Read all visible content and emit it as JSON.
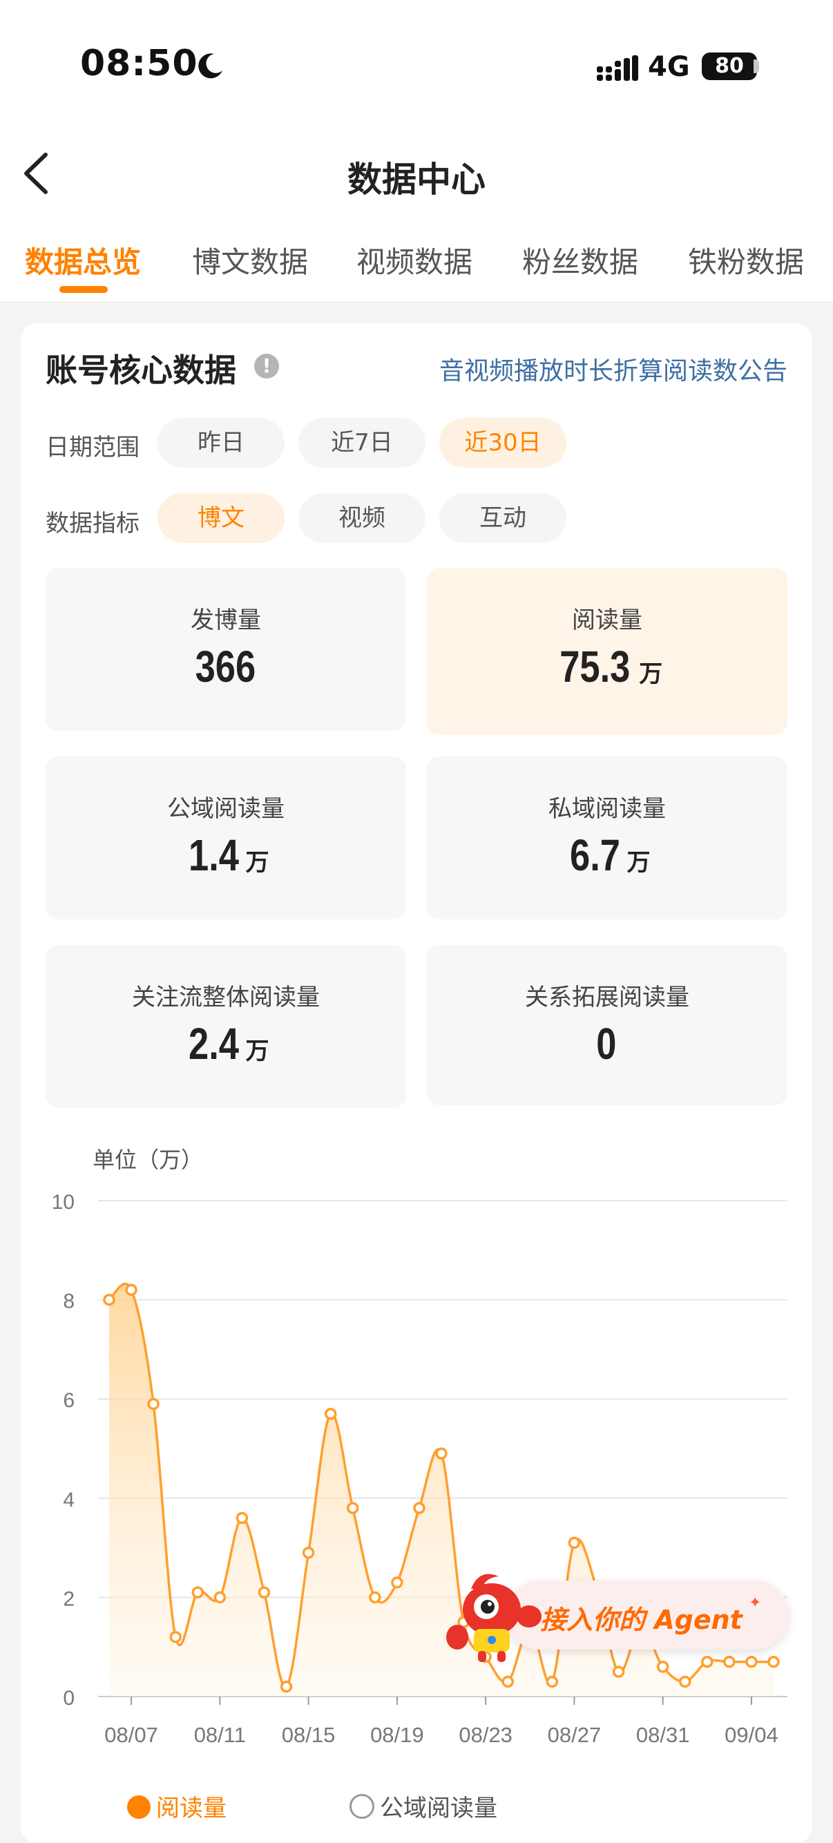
{
  "status_bar": {
    "time": "08:50",
    "network": "4G",
    "battery": "80"
  },
  "nav": {
    "title": "数据中心"
  },
  "tabs": [
    {
      "label": "数据总览",
      "active": true
    },
    {
      "label": "博文数据",
      "active": false
    },
    {
      "label": "视频数据",
      "active": false
    },
    {
      "label": "粉丝数据",
      "active": false
    },
    {
      "label": "铁粉数据",
      "active": false
    }
  ],
  "core": {
    "title": "账号核心数据",
    "info_icon": "!",
    "notice_link": "音视频播放时长折算阅读数公告",
    "date_range": {
      "label": "日期范围",
      "options": [
        "昨日",
        "近7日",
        "近30日"
      ],
      "selected": "近30日"
    },
    "metric": {
      "label": "数据指标",
      "options": [
        "博文",
        "视频",
        "互动"
      ],
      "selected": "博文"
    }
  },
  "stats": [
    {
      "label": "发博量",
      "value": "366",
      "unit": "",
      "highlight": false
    },
    {
      "label": "阅读量",
      "value": "75.3",
      "unit": "万",
      "highlight": true
    },
    {
      "label": "公域阅读量",
      "value": "1.4",
      "unit": "万",
      "highlight": false
    },
    {
      "label": "私域阅读量",
      "value": "6.7",
      "unit": "万",
      "highlight": false
    },
    {
      "label": "关注流整体阅读量",
      "value": "2.4",
      "unit": "万",
      "highlight": false
    },
    {
      "label": "关系拓展阅读量",
      "value": "0",
      "unit": "",
      "highlight": false
    }
  ],
  "chart_unit": "单位（万）",
  "chart_data": {
    "type": "area",
    "x": [
      "08/06",
      "08/07",
      "08/08",
      "08/09",
      "08/10",
      "08/11",
      "08/12",
      "08/13",
      "08/14",
      "08/15",
      "08/16",
      "08/17",
      "08/18",
      "08/19",
      "08/20",
      "08/21",
      "08/22",
      "08/23",
      "08/24",
      "08/25",
      "08/26",
      "08/27",
      "08/28",
      "08/29",
      "08/30",
      "08/31",
      "09/01",
      "09/02",
      "09/03",
      "09/04",
      "09/05"
    ],
    "series": [
      {
        "name": "阅读量",
        "values": [
          8.0,
          8.2,
          5.9,
          1.2,
          2.1,
          2.0,
          3.6,
          2.1,
          0.2,
          2.9,
          5.7,
          3.8,
          2.0,
          2.3,
          3.8,
          4.9,
          1.5,
          0.8,
          0.3,
          1.4,
          0.3,
          3.1,
          2.2,
          0.5,
          1.4,
          0.6,
          0.3,
          0.7,
          0.7,
          0.7,
          0.7
        ]
      }
    ],
    "x_tick_labels": [
      "08/07",
      "08/11",
      "08/15",
      "08/19",
      "08/23",
      "08/27",
      "08/31",
      "09/04"
    ],
    "y_ticks": [
      0,
      2,
      4,
      6,
      8,
      10
    ],
    "ylim": [
      0,
      10
    ],
    "grid": true,
    "line_color": "#ff9f2e",
    "fill_color": "#ffd89e"
  },
  "legend": [
    {
      "label": "阅读量",
      "checked": true,
      "color": "#ff8200"
    },
    {
      "label": "公域阅读量",
      "checked": false,
      "color": "#999999"
    }
  ],
  "agent_banner": {
    "label": "接入你的 Agent",
    "star": "✦"
  },
  "colors": {
    "accent": "#ff8200",
    "link": "#3e6fa3"
  }
}
